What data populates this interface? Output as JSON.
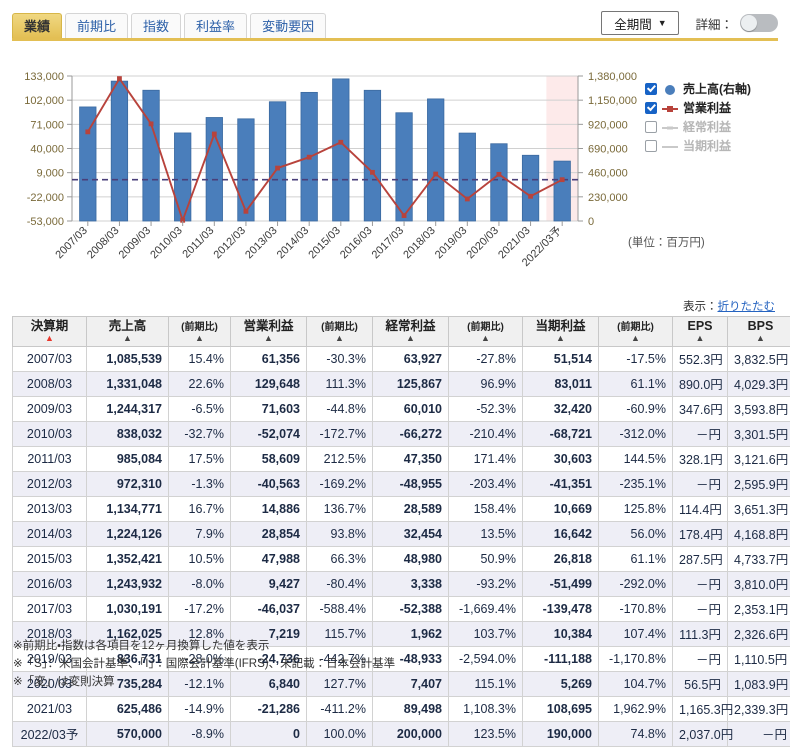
{
  "tabs": [
    {
      "label": "業績",
      "active": true
    },
    {
      "label": "前期比",
      "active": false
    },
    {
      "label": "指数",
      "active": false
    },
    {
      "label": "利益率",
      "active": false
    },
    {
      "label": "変動要因",
      "active": false
    }
  ],
  "controls": {
    "period_select_value": "全期間",
    "chevron": "▼",
    "detail_label": "詳細：",
    "detail_toggle_state": "off"
  },
  "chart_data": {
    "type": "bar",
    "title": "",
    "xlabel": "",
    "ylabel": "",
    "unit_note": "(単位：百万円)",
    "grid": true,
    "legend_position": "right",
    "categories": [
      "2007/03",
      "2008/03",
      "2009/03",
      "2010/03",
      "2011/03",
      "2012/03",
      "2013/03",
      "2014/03",
      "2015/03",
      "2016/03",
      "2017/03",
      "2018/03",
      "2019/03",
      "2020/03",
      "2021/03",
      "2022/03予"
    ],
    "forecast_category": "2022/03予",
    "left_axis": {
      "name": "営業利益",
      "ticks": [
        "-53,000",
        "-22,000",
        "9,000",
        "40,000",
        "71,000",
        "102,000",
        "133,000"
      ],
      "min": -53000,
      "max": 133000
    },
    "right_axis": {
      "name": "売上高",
      "ticks": [
        "0",
        "230,000",
        "460,000",
        "690,000",
        "920,000",
        "1,150,000",
        "1,380,000"
      ],
      "min": 0,
      "max": 1380000
    },
    "series": [
      {
        "name": "売上高(右軸)",
        "type": "bar",
        "axis": "right",
        "color": "#4a7ebb",
        "marker": "circle",
        "checked": true,
        "values": [
          1085539,
          1331048,
          1244317,
          838032,
          985084,
          972310,
          1134771,
          1224126,
          1352421,
          1243932,
          1030191,
          1162025,
          836731,
          735284,
          625486,
          570000
        ]
      },
      {
        "name": "営業利益",
        "type": "line",
        "axis": "left",
        "color": "#b8433c",
        "marker": "square",
        "checked": true,
        "values": [
          61356,
          129648,
          71603,
          -52074,
          58609,
          -40563,
          14886,
          28854,
          47988,
          9427,
          -46037,
          7219,
          -24736,
          6840,
          -21286,
          0
        ]
      },
      {
        "name": "経常利益",
        "type": "line",
        "axis": "left",
        "color": "#bbbbbb",
        "marker": "dash",
        "checked": false,
        "values": [
          63927,
          125867,
          60010,
          -66272,
          47350,
          -48955,
          28589,
          32454,
          48980,
          3338,
          -52388,
          1962,
          -48933,
          7407,
          89498,
          200000
        ]
      },
      {
        "name": "当期利益",
        "type": "line",
        "axis": "left",
        "color": "#cccccc",
        "marker": "line",
        "checked": false,
        "values": [
          51514,
          83011,
          32420,
          -68721,
          30603,
          -41351,
          10669,
          16642,
          26818,
          -51499,
          -139478,
          10384,
          -111188,
          5269,
          108695,
          190000
        ]
      }
    ]
  },
  "table": {
    "display_prefix": "表示：",
    "display_link": "折りたたむ",
    "headers": [
      {
        "label": "決算期",
        "sub": "",
        "sort_active": true
      },
      {
        "label": "売上高",
        "sub": "",
        "sort_active": false
      },
      {
        "label": "",
        "sub": "(前期比)",
        "sort_active": false
      },
      {
        "label": "営業利益",
        "sub": "",
        "sort_active": false
      },
      {
        "label": "",
        "sub": "(前期比)",
        "sort_active": false
      },
      {
        "label": "経常利益",
        "sub": "",
        "sort_active": false
      },
      {
        "label": "",
        "sub": "(前期比)",
        "sort_active": false
      },
      {
        "label": "当期利益",
        "sub": "",
        "sort_active": false
      },
      {
        "label": "",
        "sub": "(前期比)",
        "sort_active": false
      },
      {
        "label": "EPS",
        "sub": "",
        "sort_active": false
      },
      {
        "label": "BPS",
        "sub": "",
        "sort_active": false
      }
    ],
    "sort_glyph": "▲",
    "rows": [
      {
        "period": "2007/03",
        "sales": "1,085,539",
        "sales_yoy": "15.4%",
        "op": "61,356",
        "op_yoy": "-30.3%",
        "ord": "63,927",
        "ord_yoy": "-27.8%",
        "net": "51,514",
        "net_yoy": "-17.5%",
        "eps": "552.3円",
        "bps": "3,832.5円"
      },
      {
        "period": "2008/03",
        "sales": "1,331,048",
        "sales_yoy": "22.6%",
        "op": "129,648",
        "op_yoy": "111.3%",
        "ord": "125,867",
        "ord_yoy": "96.9%",
        "net": "83,011",
        "net_yoy": "61.1%",
        "eps": "890.0円",
        "bps": "4,029.3円"
      },
      {
        "period": "2009/03",
        "sales": "1,244,317",
        "sales_yoy": "-6.5%",
        "op": "71,603",
        "op_yoy": "-44.8%",
        "ord": "60,010",
        "ord_yoy": "-52.3%",
        "net": "32,420",
        "net_yoy": "-60.9%",
        "eps": "347.6円",
        "bps": "3,593.8円"
      },
      {
        "period": "2010/03",
        "sales": "838,032",
        "sales_yoy": "-32.7%",
        "op": "-52,074",
        "op_yoy": "-172.7%",
        "ord": "-66,272",
        "ord_yoy": "-210.4%",
        "net": "-68,721",
        "net_yoy": "-312.0%",
        "eps": "－円",
        "bps": "3,301.5円"
      },
      {
        "period": "2011/03",
        "sales": "985,084",
        "sales_yoy": "17.5%",
        "op": "58,609",
        "op_yoy": "212.5%",
        "ord": "47,350",
        "ord_yoy": "171.4%",
        "net": "30,603",
        "net_yoy": "144.5%",
        "eps": "328.1円",
        "bps": "3,121.6円"
      },
      {
        "period": "2012/03",
        "sales": "972,310",
        "sales_yoy": "-1.3%",
        "op": "-40,563",
        "op_yoy": "-169.2%",
        "ord": "-48,955",
        "ord_yoy": "-203.4%",
        "net": "-41,351",
        "net_yoy": "-235.1%",
        "eps": "－円",
        "bps": "2,595.9円"
      },
      {
        "period": "2013/03",
        "sales": "1,134,771",
        "sales_yoy": "16.7%",
        "op": "14,886",
        "op_yoy": "136.7%",
        "ord": "28,589",
        "ord_yoy": "158.4%",
        "net": "10,669",
        "net_yoy": "125.8%",
        "eps": "114.4円",
        "bps": "3,651.3円"
      },
      {
        "period": "2014/03",
        "sales": "1,224,126",
        "sales_yoy": "7.9%",
        "op": "28,854",
        "op_yoy": "93.8%",
        "ord": "32,454",
        "ord_yoy": "13.5%",
        "net": "16,642",
        "net_yoy": "56.0%",
        "eps": "178.4円",
        "bps": "4,168.8円"
      },
      {
        "period": "2015/03",
        "sales": "1,352,421",
        "sales_yoy": "10.5%",
        "op": "47,988",
        "op_yoy": "66.3%",
        "ord": "48,980",
        "ord_yoy": "50.9%",
        "net": "26,818",
        "net_yoy": "61.1%",
        "eps": "287.5円",
        "bps": "4,733.7円"
      },
      {
        "period": "2016/03",
        "sales": "1,243,932",
        "sales_yoy": "-8.0%",
        "op": "9,427",
        "op_yoy": "-80.4%",
        "ord": "3,338",
        "ord_yoy": "-93.2%",
        "net": "-51,499",
        "net_yoy": "-292.0%",
        "eps": "－円",
        "bps": "3,810.0円"
      },
      {
        "period": "2017/03",
        "sales": "1,030,191",
        "sales_yoy": "-17.2%",
        "op": "-46,037",
        "op_yoy": "-588.4%",
        "ord": "-52,388",
        "ord_yoy": "-1,669.4%",
        "net": "-139,478",
        "net_yoy": "-170.8%",
        "eps": "－円",
        "bps": "2,353.1円"
      },
      {
        "period": "2018/03",
        "sales": "1,162,025",
        "sales_yoy": "12.8%",
        "op": "7,219",
        "op_yoy": "115.7%",
        "ord": "1,962",
        "ord_yoy": "103.7%",
        "net": "10,384",
        "net_yoy": "107.4%",
        "eps": "111.3円",
        "bps": "2,326.6円"
      },
      {
        "period": "2019/03",
        "sales": "836,731",
        "sales_yoy": "-28.0%",
        "op": "-24,736",
        "op_yoy": "-442.7%",
        "ord": "-48,933",
        "ord_yoy": "-2,594.0%",
        "net": "-111,188",
        "net_yoy": "-1,170.8%",
        "eps": "－円",
        "bps": "1,110.5円"
      },
      {
        "period": "2020/03",
        "sales": "735,284",
        "sales_yoy": "-12.1%",
        "op": "6,840",
        "op_yoy": "127.7%",
        "ord": "7,407",
        "ord_yoy": "115.1%",
        "net": "5,269",
        "net_yoy": "104.7%",
        "eps": "56.5円",
        "bps": "1,083.9円"
      },
      {
        "period": "2021/03",
        "sales": "625,486",
        "sales_yoy": "-14.9%",
        "op": "-21,286",
        "op_yoy": "-411.2%",
        "ord": "89,498",
        "ord_yoy": "1,108.3%",
        "net": "108,695",
        "net_yoy": "1,962.9%",
        "eps": "1,165.3円",
        "bps": "2,339.3円"
      },
      {
        "period": "2022/03予",
        "sales": "570,000",
        "sales_yoy": "-8.9%",
        "op": "0",
        "op_yoy": "100.0%",
        "ord": "200,000",
        "ord_yoy": "123.5%",
        "net": "190,000",
        "net_yoy": "74.8%",
        "eps": "2,037.0円",
        "bps": "－円"
      }
    ]
  },
  "notes": [
    "※前期比・指数は各項目を12ヶ月換算した値を表示",
    "※「S」：米国会計基準、「I」：国際会計基準(IFRS)、未記載：日本会計基準",
    "※「変」は変則決算"
  ]
}
